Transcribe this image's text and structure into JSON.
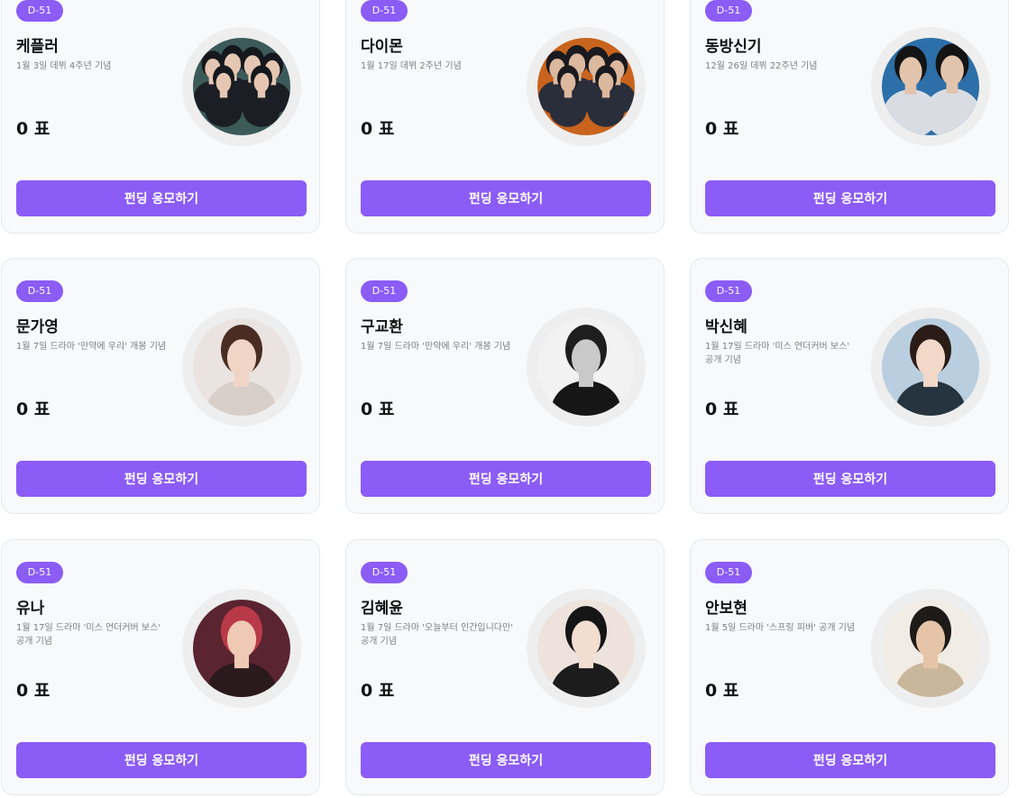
{
  "vote_unit": "표",
  "button_label": "펀딩 응모하기",
  "colors": {
    "accent": "#8b5cf6",
    "card_background": "#f8f9fb",
    "avatar_ring": "#eeeeee"
  },
  "cards": [
    {
      "badge": "D-51",
      "name": "케플러",
      "description": "1월 3일 데뷔 4주년 기념",
      "votes": "0 표",
      "button": "펀딩 응모하기",
      "photo": "group-photo",
      "photo_colors": {
        "bg": "#3c5a5a",
        "hair": "#15181c",
        "skin": "#e5c6b2",
        "cloth": "#1b1e24"
      }
    },
    {
      "badge": "D-51",
      "name": "다이몬",
      "description": "1월 17일 데뷔 2주년 기념",
      "votes": "0 표",
      "button": "펀딩 응모하기",
      "photo": "group-photo",
      "photo_colors": {
        "bg": "#c8641e",
        "hair": "#1a1a1f",
        "skin": "#dcb89e",
        "cloth": "#2a2e3a"
      }
    },
    {
      "badge": "D-51",
      "name": "동방신기",
      "description": "12월 26일 데뷔 22주년 기념",
      "votes": "0 표",
      "button": "펀딩 응모하기",
      "photo": "duo-photo",
      "photo_colors": {
        "bg": "#2d6fa8",
        "hair": "#141414",
        "skin": "#e2c4ad",
        "cloth": "#d9dde3"
      }
    },
    {
      "badge": "D-51",
      "name": "문가영",
      "description": "1월 7일 드라마 '만약에 우리' 개봉 기념",
      "votes": "0 표",
      "button": "펀딩 응모하기",
      "photo": "portrait-photo",
      "photo_colors": {
        "bg": "#eae3df",
        "hair": "#4a2c22",
        "skin": "#f0d5c6",
        "cloth": "#d8cfc8"
      }
    },
    {
      "badge": "D-51",
      "name": "구교환",
      "description": "1월 7일 드라마 '만약에 우리' 개봉 기념",
      "votes": "0 표",
      "button": "펀딩 응모하기",
      "photo": "portrait-photo",
      "photo_colors": {
        "bg": "#f2f2f2",
        "hair": "#1e1e1e",
        "skin": "#c9c9c9",
        "cloth": "#161616"
      }
    },
    {
      "badge": "D-51",
      "name": "박신혜",
      "description": "1월 17일 드라마 '미스 언더커버 보스' 공개 기념",
      "votes": "0 표",
      "button": "펀딩 응모하기",
      "photo": "portrait-photo",
      "photo_colors": {
        "bg": "#b9cfe0",
        "hair": "#2b1c18",
        "skin": "#f1d8c9",
        "cloth": "#25343e"
      }
    },
    {
      "badge": "D-51",
      "name": "유나",
      "description": "1월 17일 드라마 '미스 언더커버 보스' 공개 기념",
      "votes": "0 표",
      "button": "펀딩 응모하기",
      "photo": "portrait-photo",
      "photo_colors": {
        "bg": "#5a2430",
        "hair": "#b83a48",
        "skin": "#efc9b4",
        "cloth": "#2a1a1e"
      }
    },
    {
      "badge": "D-51",
      "name": "김혜윤",
      "description": "1월 7일 드라마 '오늘부터 인간입니다만' 공개 기념",
      "votes": "0 표",
      "button": "펀딩 응모하기",
      "photo": "portrait-photo",
      "photo_colors": {
        "bg": "#ede3dc",
        "hair": "#151515",
        "skin": "#f3dcd0",
        "cloth": "#1c1c1c"
      }
    },
    {
      "badge": "D-51",
      "name": "안보현",
      "description": "1월 5일 드라마 '스프링 피버' 공개 기념",
      "votes": "0 표",
      "button": "펀딩 응모하기",
      "photo": "portrait-photo",
      "photo_colors": {
        "bg": "#f1ece4",
        "hair": "#1d1a18",
        "skin": "#e6c4a8",
        "cloth": "#c9b79c"
      }
    }
  ]
}
